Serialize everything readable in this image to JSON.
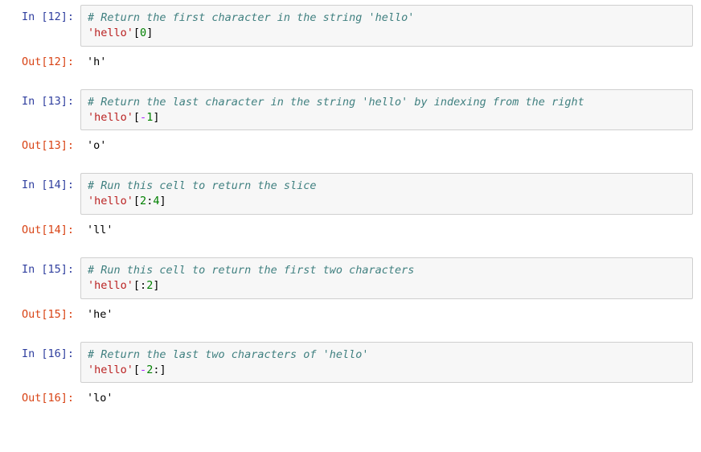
{
  "cells": [
    {
      "prompt_in": "In [12]:",
      "comment": "# Return the first character in the string 'hello'",
      "code": "'hello'[0]",
      "code_tokens": {
        "str": "'hello'",
        "bracket_open": "[",
        "num": "0",
        "op": "",
        "bracket_close": "]"
      },
      "prompt_out": "Out[12]:",
      "output": "'h'"
    },
    {
      "prompt_in": "In [13]:",
      "comment": "# Return the last character in the string 'hello' by indexing from the right",
      "code": "'hello'[-1]",
      "code_tokens": {
        "str": "'hello'",
        "bracket_open": "[",
        "op": "-",
        "num": "1",
        "bracket_close": "]"
      },
      "prompt_out": "Out[13]:",
      "output": "'o'"
    },
    {
      "prompt_in": "In [14]:",
      "comment": "# Run this cell to return the slice",
      "code": "'hello'[2:4]",
      "code_tokens": {
        "str": "'hello'",
        "bracket_open": "[",
        "num": "2",
        "op": ":",
        "num2": "4",
        "bracket_close": "]"
      },
      "prompt_out": "Out[14]:",
      "output": "'ll'"
    },
    {
      "prompt_in": "In [15]:",
      "comment": "# Run this cell to return the first two characters",
      "code": "'hello'[:2]",
      "code_tokens": {
        "str": "'hello'",
        "bracket_open": "[",
        "op": ":",
        "num": "2",
        "bracket_close": "]"
      },
      "prompt_out": "Out[15]:",
      "output": "'he'"
    },
    {
      "prompt_in": "In [16]:",
      "comment": "# Return the last two characters of 'hello'",
      "code": "'hello'[-2:]",
      "code_tokens": {
        "str": "'hello'",
        "bracket_open": "[",
        "op": "-",
        "num": "2",
        "op2": ":",
        "bracket_close": "]"
      },
      "prompt_out": "Out[16]:",
      "output": "'lo'"
    }
  ]
}
